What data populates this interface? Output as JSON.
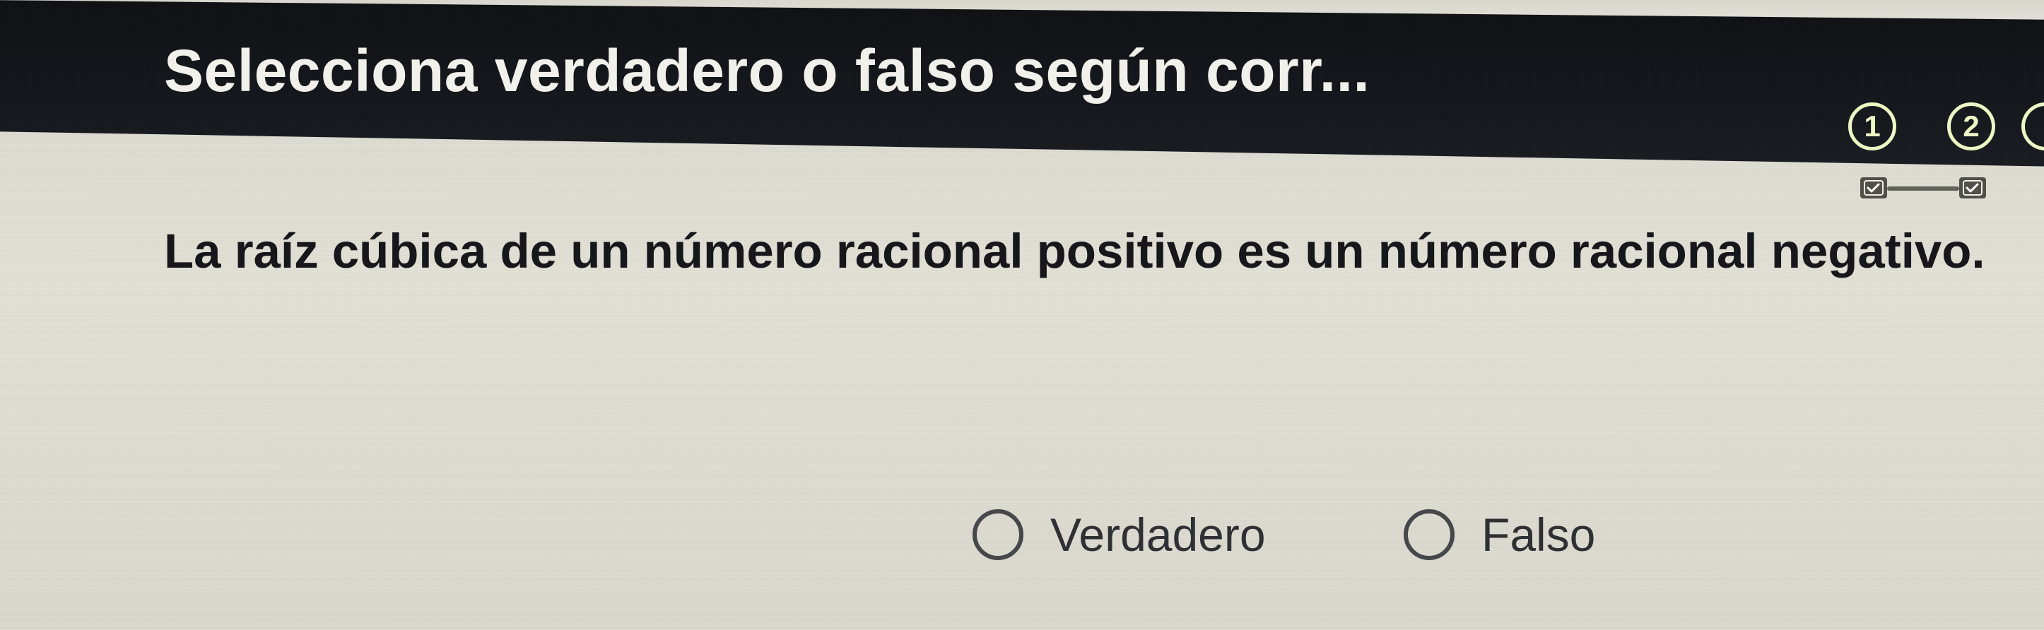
{
  "header": {
    "title": "Selecciona verdadero o falso según corr..."
  },
  "progress": {
    "steps": [
      {
        "label": "1",
        "status_icon": "check-box-icon"
      },
      {
        "label": "2",
        "status_icon": "check-box-icon"
      }
    ],
    "accent_color": "#edf7c4",
    "check_color": "#ffffff"
  },
  "question": {
    "text": "La raíz cúbica de un número racional positivo es un número racional negativo."
  },
  "answers": {
    "true_label": "Verdadero",
    "false_label": "Falso"
  }
}
